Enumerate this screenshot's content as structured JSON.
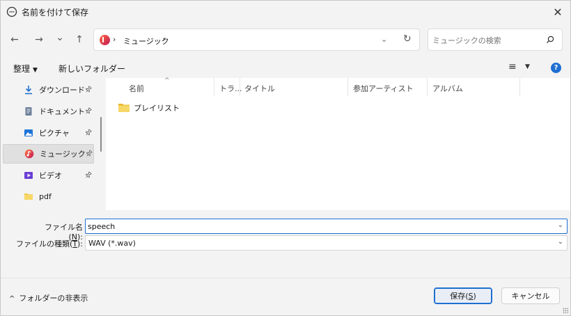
{
  "window": {
    "title": "名前を付けて保存",
    "close_symbol": "✕"
  },
  "nav": {
    "back_symbol": "←",
    "forward_symbol": "→",
    "recent_symbol": "⌄",
    "up_symbol": "↑",
    "breadcrumb_separator": "›",
    "breadcrumb": [
      "ミュージック"
    ],
    "refresh_symbol": "↻",
    "dropdown_symbol": "⌄"
  },
  "search": {
    "placeholder": "ミュージックの検索"
  },
  "toolbar": {
    "organize_label": "整理",
    "organize_caret": "▼",
    "new_folder_label": "新しいフォルダー",
    "view_symbol": "≡",
    "view_caret": "▼",
    "help_symbol": "?"
  },
  "sidebar": {
    "pin_symbol": "📌",
    "items": [
      {
        "label": "ダウンロード",
        "icon": "download-icon",
        "pinned": true
      },
      {
        "label": "ドキュメント",
        "icon": "document-icon",
        "pinned": true
      },
      {
        "label": "ピクチャ",
        "icon": "pictures-icon",
        "pinned": true
      },
      {
        "label": "ミュージック",
        "icon": "music-icon",
        "pinned": true,
        "selected": true
      },
      {
        "label": "ビデオ",
        "icon": "video-icon",
        "pinned": true
      },
      {
        "label": "pdf",
        "icon": "folder-icon",
        "pinned": false
      }
    ]
  },
  "columns": [
    {
      "label": "名前"
    },
    {
      "label": "トラ..."
    },
    {
      "label": "タイトル"
    },
    {
      "label": "参加アーティスト"
    },
    {
      "label": "アルバム"
    }
  ],
  "sort_arrow": "^",
  "files": [
    {
      "name": "プレイリスト",
      "type": "folder"
    }
  ],
  "form": {
    "filename_label_prefix": "ファイル名(",
    "filename_label_key": "N",
    "filename_label_suffix": "):",
    "filename_value": "speech",
    "filetype_label_prefix": "ファイルの種類(",
    "filetype_label_key": "T",
    "filetype_label_suffix": "):",
    "filetype_value": "WAV (*.wav)",
    "dropdown_symbol": "⌄"
  },
  "footer": {
    "hide_folders_chevron": "^",
    "hide_folders_label": "フォルダーの非表示",
    "save_label_prefix": "保存(",
    "save_label_key": "S",
    "save_label_suffix": ")",
    "cancel_label": "キャンセル"
  },
  "colors": {
    "accent": "#1f6fd1",
    "selected_bg": "#e0e0e0",
    "folder": "#f2c94c"
  }
}
